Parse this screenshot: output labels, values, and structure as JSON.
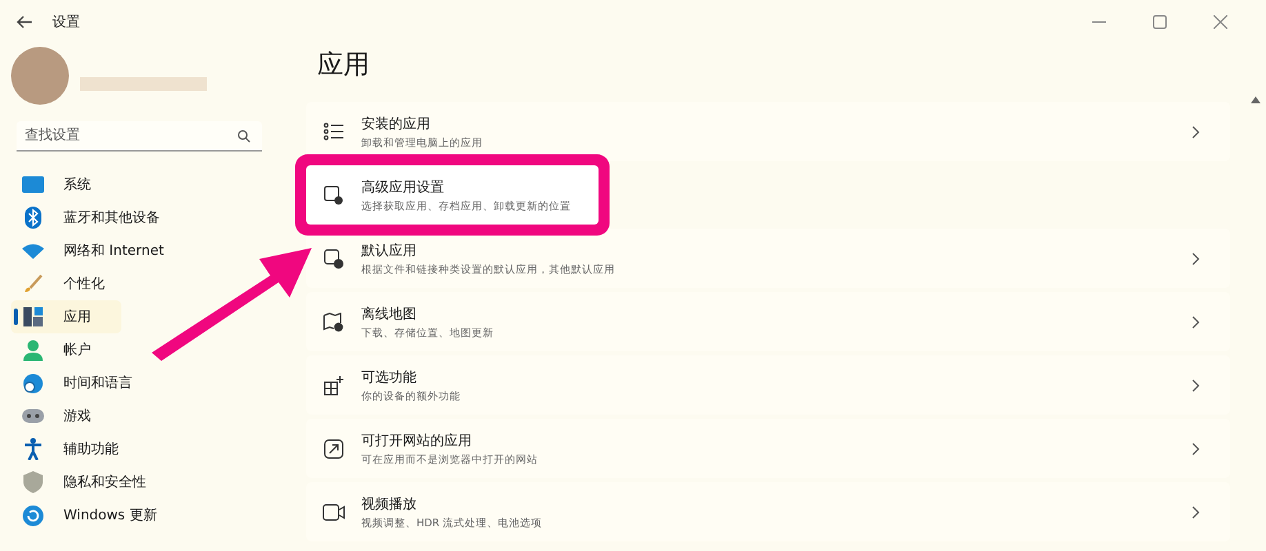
{
  "window": {
    "title": "设置"
  },
  "search": {
    "placeholder": "查找设置"
  },
  "nav": [
    {
      "label": "系统",
      "selected": false
    },
    {
      "label": "蓝牙和其他设备",
      "selected": false
    },
    {
      "label": "网络和 Internet",
      "selected": false
    },
    {
      "label": "个性化",
      "selected": false
    },
    {
      "label": "应用",
      "selected": true
    },
    {
      "label": "帐户",
      "selected": false
    },
    {
      "label": "时间和语言",
      "selected": false
    },
    {
      "label": "游戏",
      "selected": false
    },
    {
      "label": "辅助功能",
      "selected": false
    },
    {
      "label": "隐私和安全性",
      "selected": false
    },
    {
      "label": "Windows 更新",
      "selected": false
    }
  ],
  "page_title": "应用",
  "items": [
    {
      "title": "安装的应用",
      "subtitle": "卸载和管理电脑上的应用",
      "highlighted": false
    },
    {
      "title": "高级应用设置",
      "subtitle": "选择获取应用、存档应用、卸载更新的位置",
      "highlighted": true
    },
    {
      "title": "默认应用",
      "subtitle": "根据文件和链接种类设置的默认应用，其他默认应用",
      "highlighted": false
    },
    {
      "title": "离线地图",
      "subtitle": "下载、存储位置、地图更新",
      "highlighted": false
    },
    {
      "title": "可选功能",
      "subtitle": "你的设备的额外功能",
      "highlighted": false
    },
    {
      "title": "可打开网站的应用",
      "subtitle": "可在应用而不是浏览器中打开的网站",
      "highlighted": false
    },
    {
      "title": "视频播放",
      "subtitle": "视频调整、HDR 流式处理、电池选项",
      "highlighted": false
    }
  ]
}
